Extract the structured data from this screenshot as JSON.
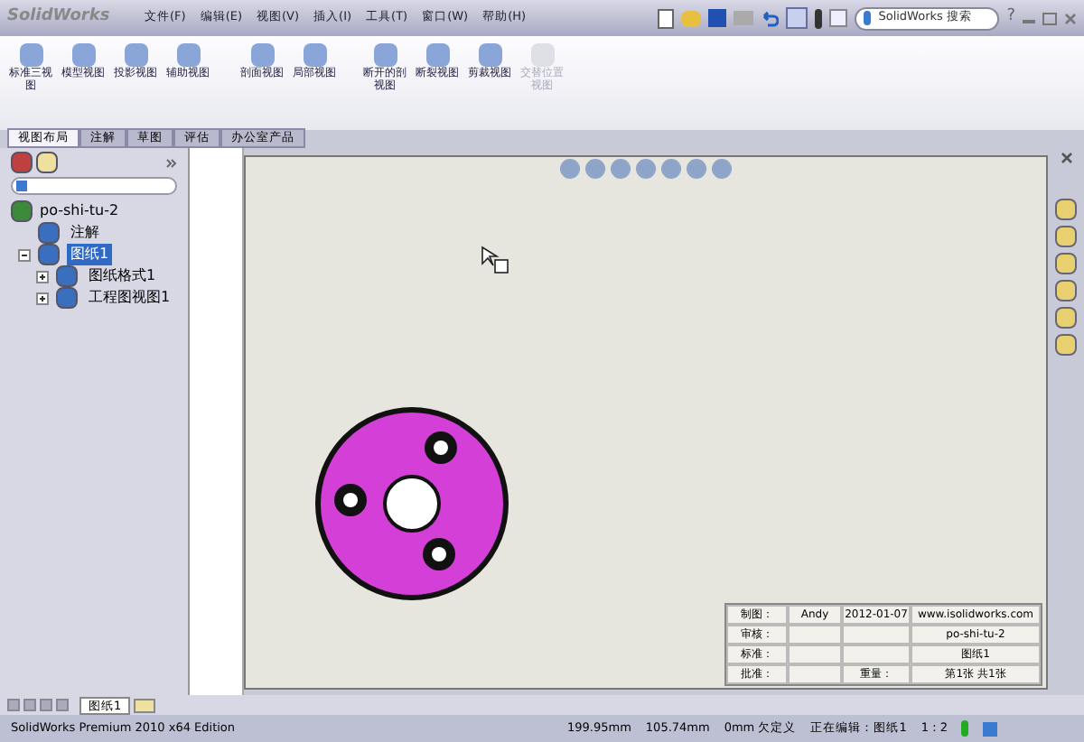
{
  "app": {
    "logo": "SolidWorks"
  },
  "menu": [
    {
      "label": "文件(F)"
    },
    {
      "label": "编辑(E)"
    },
    {
      "label": "视图(V)"
    },
    {
      "label": "插入(I)"
    },
    {
      "label": "工具(T)"
    },
    {
      "label": "窗口(W)"
    },
    {
      "label": "帮助(H)"
    }
  ],
  "search": {
    "placeholder": "SolidWorks 搜索"
  },
  "help": "?",
  "ribbon": [
    {
      "label": "标准三视图",
      "disabled": false
    },
    {
      "label": "模型视图",
      "disabled": false
    },
    {
      "label": "投影视图",
      "disabled": false
    },
    {
      "label": "辅助视图",
      "disabled": false
    },
    {
      "label": "剖面视图",
      "disabled": false
    },
    {
      "label": "局部视图",
      "disabled": false
    },
    {
      "label": "断开的剖视图",
      "disabled": false
    },
    {
      "label": "断裂视图",
      "disabled": false
    },
    {
      "label": "剪裁视图",
      "disabled": false
    },
    {
      "label": "交替位置视图",
      "disabled": true
    }
  ],
  "tabs": [
    {
      "label": "视图布局",
      "selected": true
    },
    {
      "label": "注解",
      "selected": false
    },
    {
      "label": "草图",
      "selected": false
    },
    {
      "label": "评估",
      "selected": false
    },
    {
      "label": "办公室产品",
      "selected": false
    }
  ],
  "tree": {
    "root": "po-shi-tu-2",
    "items": [
      {
        "label": "注解",
        "selected": false
      },
      {
        "label": "图纸1",
        "expanded": true,
        "selected": true,
        "children": [
          {
            "label": "图纸格式1",
            "expanded": false,
            "selected": false
          },
          {
            "label": "工程图视图1",
            "expanded": false,
            "selected": false
          }
        ]
      }
    ]
  },
  "title_block": [
    {
      "column_1": "制图：",
      "column_2": "Andy",
      "column_3": "2012-01-07",
      "column_4": "www.isolidworks.com"
    },
    {
      "column_1": "审核：",
      "column_4": "po-shi-tu-2"
    },
    {
      "column_1": "标准：",
      "column_4": "图纸1"
    },
    {
      "column_1": "批准：",
      "column_3": "重量：",
      "column_4": "第1张 共1张"
    }
  ],
  "sheet_tabs": [
    {
      "label": "图纸1",
      "selected": true
    }
  ],
  "status_bar": {
    "edition": "SolidWorks Premium 2010 x64 Edition",
    "x": "199.95mm",
    "y": "105.74mm",
    "z": "0mm",
    "state": "欠定义",
    "editing": "正在编辑：图纸1",
    "scale": "1 : 2"
  }
}
